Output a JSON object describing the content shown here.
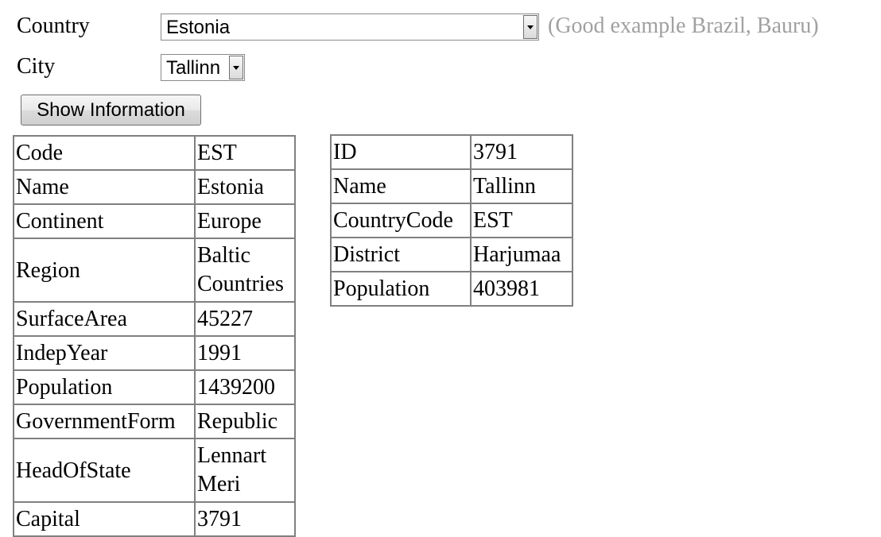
{
  "form": {
    "country_label": "Country",
    "country_value": "Estonia",
    "hint": "(Good example Brazil, Bauru)",
    "city_label": "City",
    "city_value": "Tallinn",
    "show_button_label": "Show Information"
  },
  "country_table": {
    "rows": [
      {
        "key": "Code",
        "value": "EST"
      },
      {
        "key": "Name",
        "value": "Estonia"
      },
      {
        "key": "Continent",
        "value": "Europe"
      },
      {
        "key": "Region",
        "value": "Baltic Countries"
      },
      {
        "key": "SurfaceArea",
        "value": "45227"
      },
      {
        "key": "IndepYear",
        "value": "1991"
      },
      {
        "key": "Population",
        "value": "1439200"
      },
      {
        "key": "GovernmentForm",
        "value": "Republic"
      },
      {
        "key": "HeadOfState",
        "value": "Lennart Meri"
      },
      {
        "key": "Capital",
        "value": "3791"
      }
    ]
  },
  "city_table": {
    "rows": [
      {
        "key": "ID",
        "value": "3791"
      },
      {
        "key": "Name",
        "value": "Tallinn"
      },
      {
        "key": "CountryCode",
        "value": "EST"
      },
      {
        "key": "District",
        "value": "Harjumaa"
      },
      {
        "key": "Population",
        "value": "403981"
      }
    ]
  },
  "colors": {
    "hint_text": "#a0a0a0",
    "table_border": "#808080"
  }
}
